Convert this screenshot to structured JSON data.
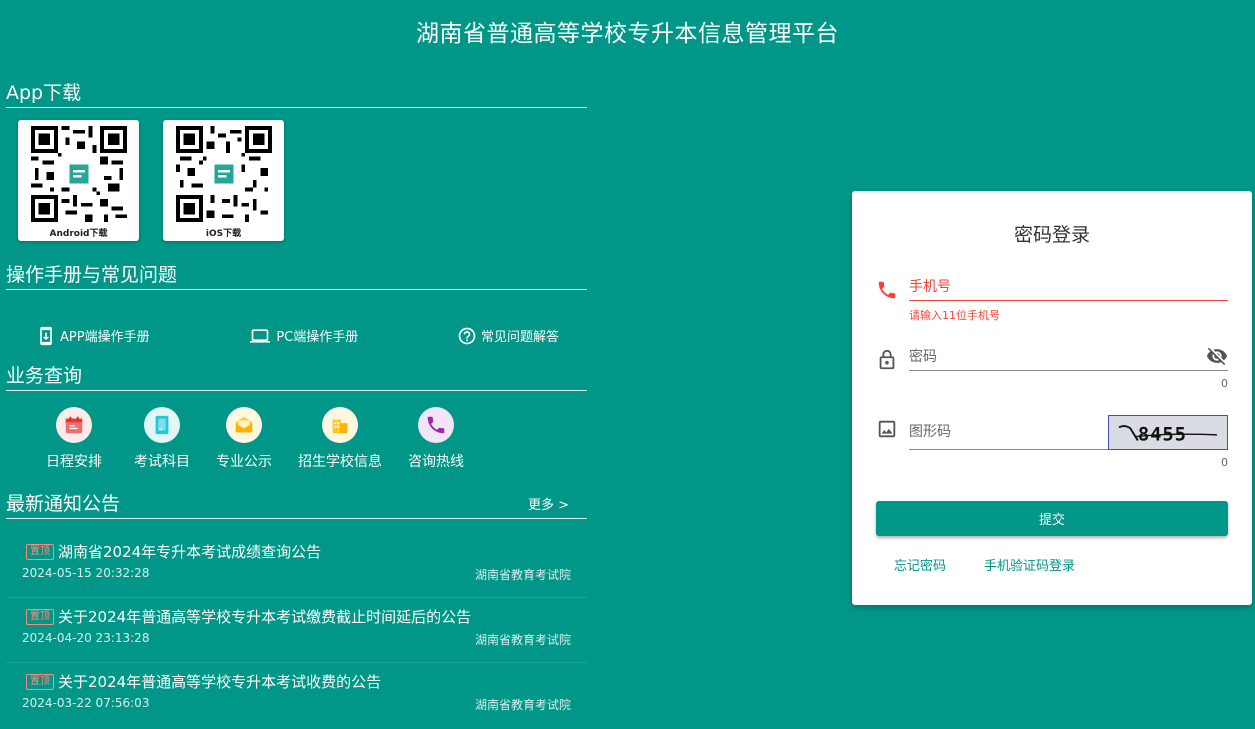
{
  "header": {
    "title": "湖南省普通高等学校专升本信息管理平台"
  },
  "app_download": {
    "title": "App下载",
    "android_label": "Android下载",
    "ios_label": "iOS下载"
  },
  "manuals": {
    "title": "操作手册与常见问题",
    "items": [
      {
        "label": "APP端操作手册",
        "icon": "phone-download-icon"
      },
      {
        "label": "PC端操作手册",
        "icon": "laptop-icon"
      },
      {
        "label": "常见问题解答",
        "icon": "help-circle-icon"
      }
    ]
  },
  "business": {
    "title": "业务查询",
    "items": [
      {
        "label": "日程安排",
        "icon": "calendar-icon"
      },
      {
        "label": "考试科目",
        "icon": "book-icon"
      },
      {
        "label": "专业公示",
        "icon": "envelope-icon"
      },
      {
        "label": "招生学校信息",
        "icon": "building-icon"
      },
      {
        "label": "咨询热线",
        "icon": "phone-icon"
      }
    ]
  },
  "notices": {
    "title": "最新通知公告",
    "more_label": "更多 >",
    "top_badge": "置顶",
    "items": [
      {
        "title": "湖南省2024年专升本考试成绩查询公告",
        "date": "2024-05-15 20:32:28",
        "source": "湖南省教育考试院"
      },
      {
        "title": "关于2024年普通高等学校专升本考试缴费截止时间延后的公告",
        "date": "2024-04-20 23:13:28",
        "source": "湖南省教育考试院"
      },
      {
        "title": "关于2024年普通高等学校专升本考试收费的公告",
        "date": "2024-03-22 07:56:03",
        "source": "湖南省教育考试院"
      }
    ]
  },
  "login": {
    "title": "密码登录",
    "phone_placeholder": "手机号",
    "phone_error": "请输入11位手机号",
    "password_placeholder": "密码",
    "password_counter": "0",
    "captcha_placeholder": "图形码",
    "captcha_counter": "0",
    "captcha_text": "8455",
    "submit_label": "提交",
    "forgot_label": "忘记密码",
    "sms_login_label": "手机验证码登录"
  },
  "colors": {
    "primary": "#009688",
    "error": "#f44336",
    "badge": "#ff8a80"
  }
}
